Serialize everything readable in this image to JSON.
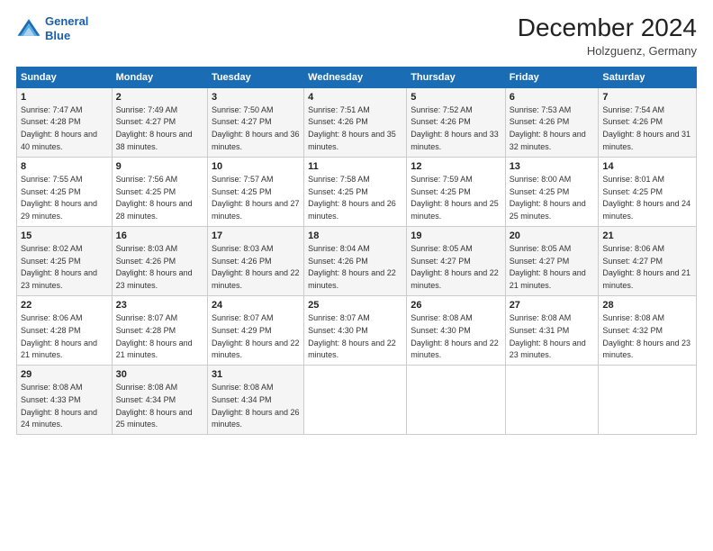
{
  "header": {
    "logo_line1": "General",
    "logo_line2": "Blue",
    "title": "December 2024",
    "subtitle": "Holzguenz, Germany"
  },
  "days_of_week": [
    "Sunday",
    "Monday",
    "Tuesday",
    "Wednesday",
    "Thursday",
    "Friday",
    "Saturday"
  ],
  "weeks": [
    [
      {
        "day": "1",
        "rise": "Sunrise: 7:47 AM",
        "set": "Sunset: 4:28 PM",
        "daylight": "Daylight: 8 hours and 40 minutes."
      },
      {
        "day": "2",
        "rise": "Sunrise: 7:49 AM",
        "set": "Sunset: 4:27 PM",
        "daylight": "Daylight: 8 hours and 38 minutes."
      },
      {
        "day": "3",
        "rise": "Sunrise: 7:50 AM",
        "set": "Sunset: 4:27 PM",
        "daylight": "Daylight: 8 hours and 36 minutes."
      },
      {
        "day": "4",
        "rise": "Sunrise: 7:51 AM",
        "set": "Sunset: 4:26 PM",
        "daylight": "Daylight: 8 hours and 35 minutes."
      },
      {
        "day": "5",
        "rise": "Sunrise: 7:52 AM",
        "set": "Sunset: 4:26 PM",
        "daylight": "Daylight: 8 hours and 33 minutes."
      },
      {
        "day": "6",
        "rise": "Sunrise: 7:53 AM",
        "set": "Sunset: 4:26 PM",
        "daylight": "Daylight: 8 hours and 32 minutes."
      },
      {
        "day": "7",
        "rise": "Sunrise: 7:54 AM",
        "set": "Sunset: 4:26 PM",
        "daylight": "Daylight: 8 hours and 31 minutes."
      }
    ],
    [
      {
        "day": "8",
        "rise": "Sunrise: 7:55 AM",
        "set": "Sunset: 4:25 PM",
        "daylight": "Daylight: 8 hours and 29 minutes."
      },
      {
        "day": "9",
        "rise": "Sunrise: 7:56 AM",
        "set": "Sunset: 4:25 PM",
        "daylight": "Daylight: 8 hours and 28 minutes."
      },
      {
        "day": "10",
        "rise": "Sunrise: 7:57 AM",
        "set": "Sunset: 4:25 PM",
        "daylight": "Daylight: 8 hours and 27 minutes."
      },
      {
        "day": "11",
        "rise": "Sunrise: 7:58 AM",
        "set": "Sunset: 4:25 PM",
        "daylight": "Daylight: 8 hours and 26 minutes."
      },
      {
        "day": "12",
        "rise": "Sunrise: 7:59 AM",
        "set": "Sunset: 4:25 PM",
        "daylight": "Daylight: 8 hours and 25 minutes."
      },
      {
        "day": "13",
        "rise": "Sunrise: 8:00 AM",
        "set": "Sunset: 4:25 PM",
        "daylight": "Daylight: 8 hours and 25 minutes."
      },
      {
        "day": "14",
        "rise": "Sunrise: 8:01 AM",
        "set": "Sunset: 4:25 PM",
        "daylight": "Daylight: 8 hours and 24 minutes."
      }
    ],
    [
      {
        "day": "15",
        "rise": "Sunrise: 8:02 AM",
        "set": "Sunset: 4:25 PM",
        "daylight": "Daylight: 8 hours and 23 minutes."
      },
      {
        "day": "16",
        "rise": "Sunrise: 8:03 AM",
        "set": "Sunset: 4:26 PM",
        "daylight": "Daylight: 8 hours and 23 minutes."
      },
      {
        "day": "17",
        "rise": "Sunrise: 8:03 AM",
        "set": "Sunset: 4:26 PM",
        "daylight": "Daylight: 8 hours and 22 minutes."
      },
      {
        "day": "18",
        "rise": "Sunrise: 8:04 AM",
        "set": "Sunset: 4:26 PM",
        "daylight": "Daylight: 8 hours and 22 minutes."
      },
      {
        "day": "19",
        "rise": "Sunrise: 8:05 AM",
        "set": "Sunset: 4:27 PM",
        "daylight": "Daylight: 8 hours and 22 minutes."
      },
      {
        "day": "20",
        "rise": "Sunrise: 8:05 AM",
        "set": "Sunset: 4:27 PM",
        "daylight": "Daylight: 8 hours and 21 minutes."
      },
      {
        "day": "21",
        "rise": "Sunrise: 8:06 AM",
        "set": "Sunset: 4:27 PM",
        "daylight": "Daylight: 8 hours and 21 minutes."
      }
    ],
    [
      {
        "day": "22",
        "rise": "Sunrise: 8:06 AM",
        "set": "Sunset: 4:28 PM",
        "daylight": "Daylight: 8 hours and 21 minutes."
      },
      {
        "day": "23",
        "rise": "Sunrise: 8:07 AM",
        "set": "Sunset: 4:28 PM",
        "daylight": "Daylight: 8 hours and 21 minutes."
      },
      {
        "day": "24",
        "rise": "Sunrise: 8:07 AM",
        "set": "Sunset: 4:29 PM",
        "daylight": "Daylight: 8 hours and 22 minutes."
      },
      {
        "day": "25",
        "rise": "Sunrise: 8:07 AM",
        "set": "Sunset: 4:30 PM",
        "daylight": "Daylight: 8 hours and 22 minutes."
      },
      {
        "day": "26",
        "rise": "Sunrise: 8:08 AM",
        "set": "Sunset: 4:30 PM",
        "daylight": "Daylight: 8 hours and 22 minutes."
      },
      {
        "day": "27",
        "rise": "Sunrise: 8:08 AM",
        "set": "Sunset: 4:31 PM",
        "daylight": "Daylight: 8 hours and 23 minutes."
      },
      {
        "day": "28",
        "rise": "Sunrise: 8:08 AM",
        "set": "Sunset: 4:32 PM",
        "daylight": "Daylight: 8 hours and 23 minutes."
      }
    ],
    [
      {
        "day": "29",
        "rise": "Sunrise: 8:08 AM",
        "set": "Sunset: 4:33 PM",
        "daylight": "Daylight: 8 hours and 24 minutes."
      },
      {
        "day": "30",
        "rise": "Sunrise: 8:08 AM",
        "set": "Sunset: 4:34 PM",
        "daylight": "Daylight: 8 hours and 25 minutes."
      },
      {
        "day": "31",
        "rise": "Sunrise: 8:08 AM",
        "set": "Sunset: 4:34 PM",
        "daylight": "Daylight: 8 hours and 26 minutes."
      },
      null,
      null,
      null,
      null
    ]
  ]
}
